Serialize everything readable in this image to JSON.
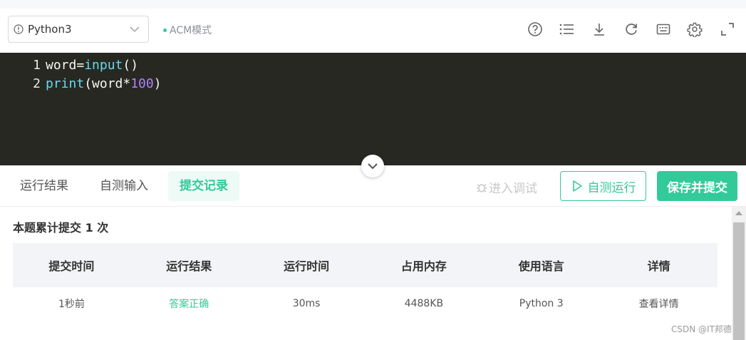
{
  "toolbar": {
    "language": "Python3",
    "mode_label": "ACM模式",
    "icons": [
      "help-icon",
      "list-icon",
      "download-icon",
      "refresh-icon",
      "keyboard-icon",
      "settings-icon",
      "fullscreen-icon"
    ]
  },
  "editor": {
    "lines": [
      {
        "number": "1",
        "tokens": [
          {
            "text": "word",
            "kind": "plain"
          },
          {
            "text": "=",
            "kind": "op"
          },
          {
            "text": "input",
            "kind": "fn"
          },
          {
            "text": "()",
            "kind": "plain"
          }
        ]
      },
      {
        "number": "2",
        "tokens": [
          {
            "text": "print",
            "kind": "fn"
          },
          {
            "text": "(word*",
            "kind": "plain"
          },
          {
            "text": "100",
            "kind": "num"
          },
          {
            "text": ")",
            "kind": "plain"
          }
        ]
      }
    ]
  },
  "tabs": [
    {
      "label": "运行结果",
      "active": false
    },
    {
      "label": "自测输入",
      "active": false
    },
    {
      "label": "提交记录",
      "active": true
    }
  ],
  "actions": {
    "debug_label": "进入调试",
    "run_label": "自测运行",
    "submit_label": "保存并提交"
  },
  "results": {
    "summary": "本题累计提交 1 次",
    "columns": [
      "提交时间",
      "运行结果",
      "运行时间",
      "占用内存",
      "使用语言",
      "详情"
    ],
    "rows": [
      {
        "time": "1秒前",
        "result": "答案正确",
        "runtime": "30ms",
        "memory": "4488KB",
        "language": "Python 3",
        "detail": "查看详情"
      }
    ]
  },
  "watermark": "CSDN @IT邦德",
  "colors": {
    "accent": "#32ca99",
    "editor_bg": "#272822",
    "fn": "#66d9ef",
    "num": "#ae81ff"
  }
}
